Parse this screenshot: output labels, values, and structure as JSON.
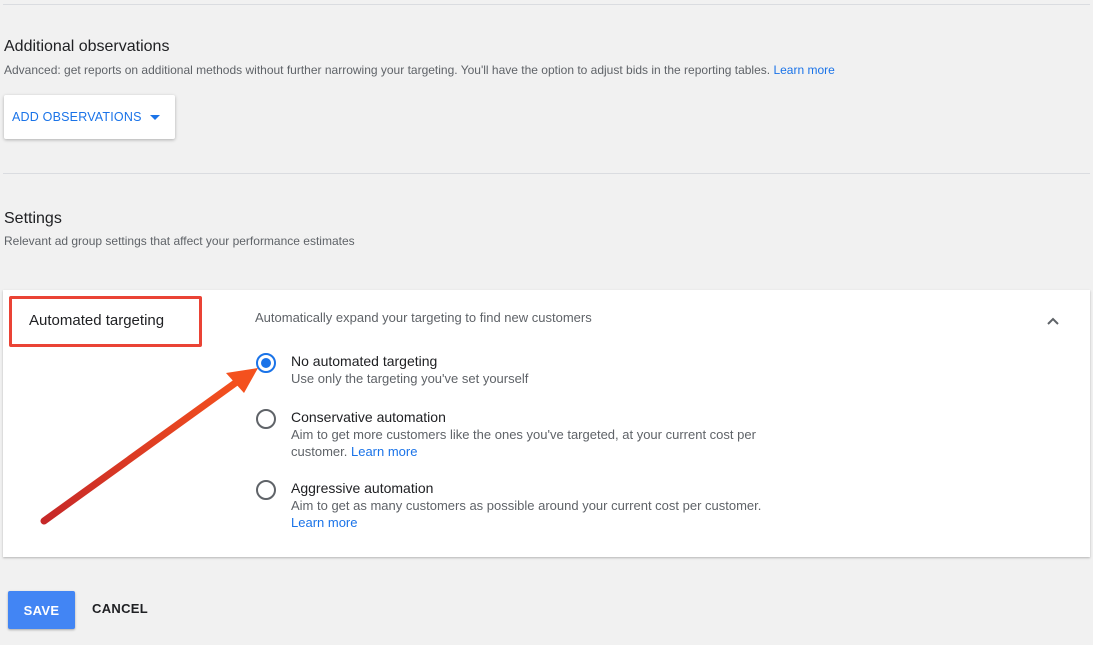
{
  "observations": {
    "title": "Additional observations",
    "description": "Advanced: get reports on additional methods without further narrowing your targeting. You'll have the option to adjust bids in the reporting tables.",
    "learn_more": "Learn more",
    "add_button_label": "ADD OBSERVATIONS"
  },
  "settings": {
    "title": "Settings",
    "description": "Relevant ad group settings that affect your performance estimates"
  },
  "targeting": {
    "label": "Automated targeting",
    "summary": "Automatically expand your targeting to find new customers",
    "selected_option": "No automated targeting",
    "options": [
      {
        "title": "No automated targeting",
        "description": "Use only the targeting you've set yourself",
        "learn_more": "",
        "checked": true
      },
      {
        "title": "Conservative automation",
        "description": "Aim to get more customers like the ones you've targeted, at your current cost per customer.",
        "learn_more": "Learn more",
        "checked": false
      },
      {
        "title": "Aggressive automation",
        "description": "Aim to get as many customers as possible around your current cost per customer.",
        "learn_more": "Learn more",
        "checked": false
      }
    ]
  },
  "actions": {
    "save_label": "SAVE",
    "cancel_label": "CANCEL"
  },
  "colors": {
    "accent": "#1a73e8",
    "save_button": "#4285f4",
    "annotation": "#ea4335"
  },
  "icons": {
    "dropdown": "caret-down-icon",
    "collapse": "chevron-up-icon",
    "annotation_arrow": "annotation-arrow"
  }
}
